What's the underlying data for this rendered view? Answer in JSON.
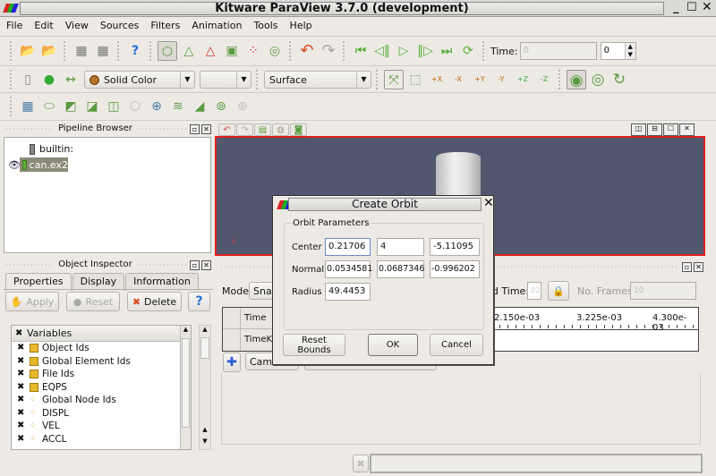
{
  "window": {
    "title": "Kitware ParaView 3.7.0 (development)"
  },
  "menu": [
    "File",
    "Edit",
    "View",
    "Sources",
    "Filters",
    "Animation",
    "Tools",
    "Help"
  ],
  "toolbar": {
    "time_label": "Time:",
    "time_value": "0",
    "time_step": "0",
    "color_by": "Solid Color",
    "color_component": "",
    "representation": "Surface",
    "camera_buttons": [
      "+X",
      "-X",
      "+Y",
      "-Y",
      "+Z",
      "-Z"
    ]
  },
  "pipeline": {
    "title": "Pipeline Browser",
    "items": [
      {
        "label": "builtin:"
      },
      {
        "label": "can.ex2"
      }
    ]
  },
  "inspector": {
    "title": "Object Inspector",
    "tabs": [
      "Properties",
      "Display",
      "Information"
    ],
    "apply": "Apply",
    "reset": "Reset",
    "delete": "Delete",
    "help": "?",
    "variables_header": "Variables",
    "variables": [
      {
        "label": "Object Ids",
        "type": "cell"
      },
      {
        "label": "Global Element Ids",
        "type": "cell"
      },
      {
        "label": "File Ids",
        "type": "cell"
      },
      {
        "label": "EQPS",
        "type": "cell"
      },
      {
        "label": "Global Node Ids",
        "type": "point"
      },
      {
        "label": "DISPL",
        "type": "point"
      },
      {
        "label": "VEL",
        "type": "point"
      },
      {
        "label": "ACCL",
        "type": "point"
      }
    ]
  },
  "animation": {
    "mode_label": "Mode:",
    "mode_value": "Snap",
    "end_time_label": "End Time:",
    "end_time_value": "02",
    "frames_label": "No. Frames:",
    "frames_value": "10",
    "rows": [
      "Time",
      "TimeKe"
    ],
    "ticks": [
      "2.150e-03",
      "3.225e-03",
      "4.300e-03"
    ],
    "track_source": "Came"
  },
  "dialog": {
    "title": "Create Orbit",
    "group": "Orbit Parameters",
    "center_label": "Center",
    "center": [
      "0.21706",
      "4",
      "-5.11095"
    ],
    "normal_label": "Normal",
    "normal": [
      "0.0534581",
      "0.0687346",
      "-0.996202"
    ],
    "radius_label": "Radius",
    "radius": "49.4453",
    "reset_bounds": "Reset Bounds",
    "ok": "OK",
    "cancel": "Cancel"
  },
  "colors": {
    "viewport_bg": "#525770",
    "active_border": "#e02020",
    "selection": "#8c8a78"
  }
}
